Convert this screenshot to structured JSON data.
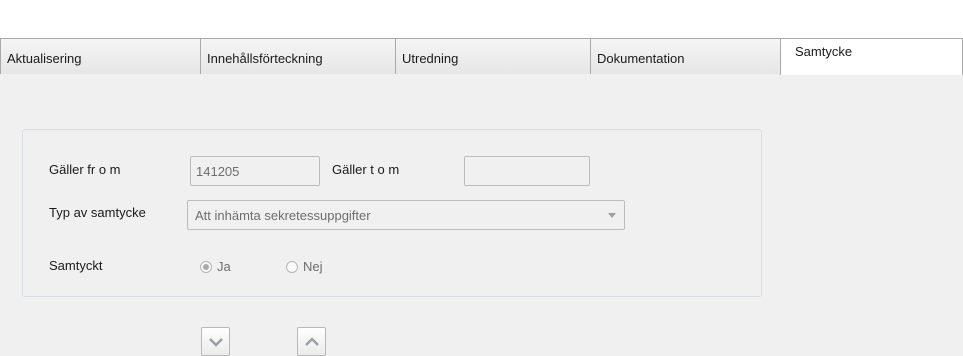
{
  "tabs": [
    {
      "label": "Aktualisering"
    },
    {
      "label": "Innehållsförteckning"
    },
    {
      "label": "Utredning"
    },
    {
      "label": "Dokumentation"
    },
    {
      "label": "Samtycke"
    }
  ],
  "form": {
    "galler_from_label": "Gäller fr o m",
    "galler_from_value": "141205",
    "galler_tom_label": "Gäller t o m",
    "galler_tom_value": "",
    "typ_label": "Typ av samtycke",
    "typ_value": "Att inhämta sekretessuppgifter",
    "samtyckt_label": "Samtyckt",
    "option_ja": "Ja",
    "option_nej": "Nej",
    "selected_option": "Ja"
  },
  "icons": {
    "down_button": "chevron-down-icon",
    "up_button": "chevron-up-icon"
  },
  "colors": {
    "background": "#f0f0f0",
    "tab_active": "#ffffff",
    "border": "#a9a9a9",
    "disabled_text": "#6d6d6d"
  }
}
